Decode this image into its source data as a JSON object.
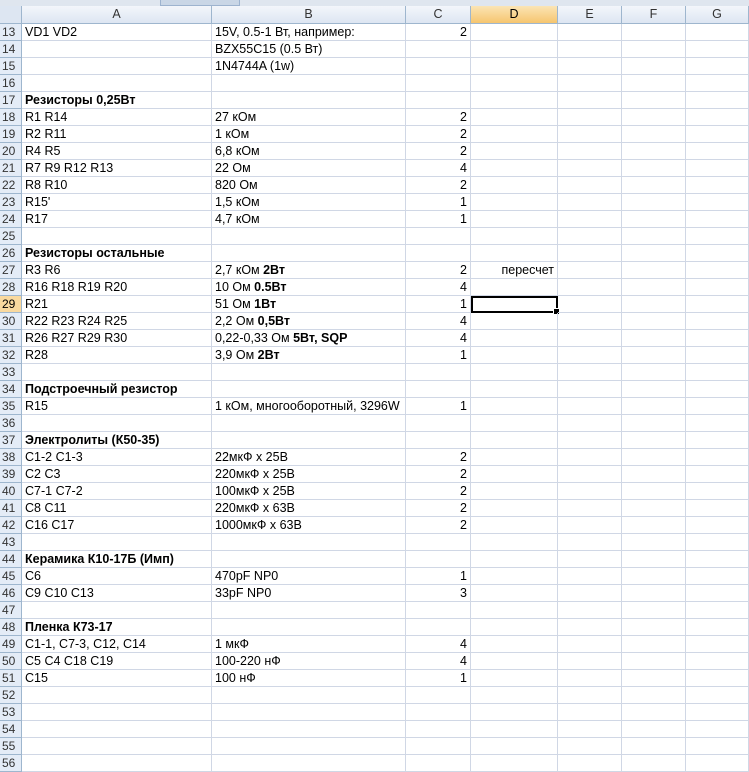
{
  "columns": [
    "A",
    "B",
    "C",
    "D",
    "E",
    "F",
    "G"
  ],
  "selected_cell": {
    "row": "29",
    "column": "D"
  },
  "rows": [
    {
      "n": "13",
      "a": "VD1 VD2",
      "b": [
        {
          "t": "15V, 0.5-1 Вт, например:"
        }
      ],
      "c": "2"
    },
    {
      "n": "14",
      "a": "",
      "b": [
        {
          "t": "BZX55C15 (0.5 Вт)"
        }
      ],
      "c": ""
    },
    {
      "n": "15",
      "a": "",
      "b": [
        {
          "t": "1N4744A (1w)"
        }
      ],
      "c": ""
    },
    {
      "n": "16",
      "a": "",
      "b": [],
      "c": ""
    },
    {
      "n": "17",
      "a": "Резисторы 0,25Вт",
      "ab": true,
      "b": [],
      "c": ""
    },
    {
      "n": "18",
      "a": "R1 R14",
      "b": [
        {
          "t": "27 кОм"
        }
      ],
      "c": "2"
    },
    {
      "n": "19",
      "a": "R2 R11",
      "b": [
        {
          "t": "1 кОм"
        }
      ],
      "c": "2"
    },
    {
      "n": "20",
      "a": "R4 R5",
      "b": [
        {
          "t": "6,8 кОм"
        }
      ],
      "c": "2"
    },
    {
      "n": "21",
      "a": "R7 R9 R12 R13",
      "b": [
        {
          "t": "22 Ом"
        }
      ],
      "c": "4"
    },
    {
      "n": "22",
      "a": "R8 R10",
      "b": [
        {
          "t": "820 Ом"
        }
      ],
      "c": "2"
    },
    {
      "n": "23",
      "a": "R15'",
      "b": [
        {
          "t": "1,5 кОм"
        }
      ],
      "c": "1"
    },
    {
      "n": "24",
      "a": "R17",
      "b": [
        {
          "t": "4,7 кОм"
        }
      ],
      "c": "1"
    },
    {
      "n": "25",
      "a": "",
      "b": [],
      "c": ""
    },
    {
      "n": "26",
      "a": "Резисторы остальные",
      "ab": true,
      "b": [],
      "c": ""
    },
    {
      "n": "27",
      "a": "R3 R6",
      "b": [
        {
          "t": "2,7 кОм "
        },
        {
          "t": "2Вт",
          "bold": true
        }
      ],
      "c": "2",
      "d": "пересчет"
    },
    {
      "n": "28",
      "a": "R16 R18 R19 R20",
      "b": [
        {
          "t": "10 Ом  "
        },
        {
          "t": "0.5Вт",
          "bold": true
        }
      ],
      "c": "4"
    },
    {
      "n": "29",
      "a": "R21",
      "b": [
        {
          "t": "51 Ом "
        },
        {
          "t": "1Вт",
          "bold": true
        }
      ],
      "c": "1"
    },
    {
      "n": "30",
      "a": "R22 R23 R24 R25",
      "b": [
        {
          "t": "2,2 Ом "
        },
        {
          "t": "0,5Вт",
          "bold": true
        }
      ],
      "c": "4"
    },
    {
      "n": "31",
      "a": "R26 R27 R29 R30",
      "b": [
        {
          "t": "0,22-0,33 Ом "
        },
        {
          "t": "5Вт, SQP",
          "bold": true
        }
      ],
      "c": "4"
    },
    {
      "n": "32",
      "a": "R28",
      "b": [
        {
          "t": "3,9 Ом "
        },
        {
          "t": "2Вт",
          "bold": true
        }
      ],
      "c": "1"
    },
    {
      "n": "33",
      "a": "",
      "b": [],
      "c": ""
    },
    {
      "n": "34",
      "a": "Подстроечный резистор",
      "ab": true,
      "b": [],
      "c": ""
    },
    {
      "n": "35",
      "a": "R15",
      "b": [
        {
          "t": "1 кОм, многооборотный, 3296W"
        }
      ],
      "c": "1"
    },
    {
      "n": "36",
      "a": "",
      "b": [],
      "c": ""
    },
    {
      "n": "37",
      "a": "Электролиты (К50-35)",
      "ab": true,
      "b": [],
      "c": ""
    },
    {
      "n": "38",
      "a": "C1-2 C1-3",
      "b": [
        {
          "t": "22мкФ х 25В"
        }
      ],
      "c": "2"
    },
    {
      "n": "39",
      "a": "C2 C3",
      "b": [
        {
          "t": "220мкФ х 25В"
        }
      ],
      "c": "2"
    },
    {
      "n": "40",
      "a": "C7-1 C7-2",
      "b": [
        {
          "t": "100мкФ х 25В"
        }
      ],
      "c": "2"
    },
    {
      "n": "41",
      "a": "C8 C11",
      "b": [
        {
          "t": "220мкФ х 63В"
        }
      ],
      "c": "2"
    },
    {
      "n": "42",
      "a": "C16 C17",
      "b": [
        {
          "t": "1000мкФ х 63В"
        }
      ],
      "c": "2"
    },
    {
      "n": "43",
      "a": "",
      "b": [],
      "c": ""
    },
    {
      "n": "44",
      "a": "Керамика К10-17Б (Имп)",
      "ab": true,
      "b": [],
      "c": ""
    },
    {
      "n": "45",
      "a": "C6",
      "b": [
        {
          "t": "470pF NP0"
        }
      ],
      "c": "1"
    },
    {
      "n": "46",
      "a": "C9 C10 C13",
      "b": [
        {
          "t": "33pF NP0"
        }
      ],
      "c": "3"
    },
    {
      "n": "47",
      "a": "",
      "b": [],
      "c": ""
    },
    {
      "n": "48",
      "a": "Пленка К73-17",
      "ab": true,
      "b": [],
      "c": ""
    },
    {
      "n": "49",
      "a": "C1-1, C7-3, C12, C14",
      "b": [
        {
          "t": "1 мкФ"
        }
      ],
      "c": "4"
    },
    {
      "n": "50",
      "a": "C5 C4 C18 C19",
      "b": [
        {
          "t": "100-220 нФ"
        }
      ],
      "c": "4"
    },
    {
      "n": "51",
      "a": "C15",
      "b": [
        {
          "t": "100 нФ"
        }
      ],
      "c": "1"
    },
    {
      "n": "52",
      "a": "",
      "b": [],
      "c": ""
    },
    {
      "n": "53",
      "a": "",
      "b": [],
      "c": ""
    },
    {
      "n": "54",
      "a": "",
      "b": [],
      "c": ""
    },
    {
      "n": "55",
      "a": "",
      "b": [],
      "c": ""
    },
    {
      "n": "56",
      "a": "",
      "b": [],
      "c": ""
    }
  ]
}
